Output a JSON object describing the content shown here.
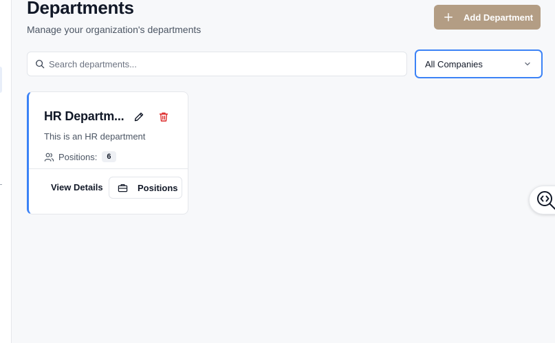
{
  "header": {
    "title": "Departments",
    "subtitle": "Manage your organization's departments",
    "add_button_label": "Add Department"
  },
  "filters": {
    "search_placeholder": "Search departments...",
    "search_value": "",
    "company_select_value": "All Companies"
  },
  "departments": [
    {
      "name": "HR Departm...",
      "description": "This is an HR department",
      "positions_label": "Positions:",
      "positions_count": "6",
      "view_details_label": "View Details",
      "positions_button_label": "Positions"
    }
  ],
  "colors": {
    "accent": "#3b82f6",
    "add_button_bg": "#b39d84",
    "delete_icon": "#dc2626"
  },
  "icons": {
    "add": "plus-icon",
    "search": "search-icon",
    "select": "chevron-down-icon",
    "edit": "pencil-icon",
    "delete": "trash-icon",
    "positions": "users-icon",
    "positions_button": "briefcase-icon",
    "widget": "code-search-icon"
  }
}
